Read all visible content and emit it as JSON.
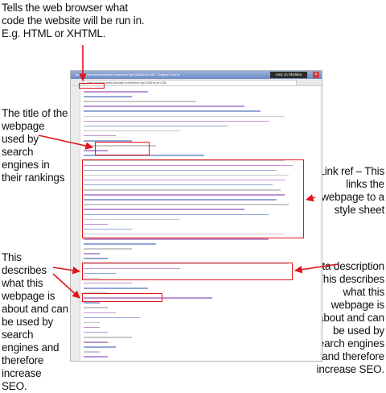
{
  "annotations": {
    "doctype": "Tells the web browser what code the website will be run in. E.g. HTML or XHTML.",
    "title": "The title of the webpage used by search engines in their rankings",
    "link_ref": "Link ref – This links the webpage to a style sheet",
    "meta_left": "This describes what this webpage is about and can be used by search engines and therefore increase SEO.",
    "meta_right": "Meta description – This describes what this webpage is about and can be used by search engines and therefore increase SEO."
  },
  "browser": {
    "tab": "view-source:www.youtube.com/index?gl=GB&hl=en-GB - Original Source",
    "user": "Amy Jo Sheldon",
    "url": "view-source:www.youtube.com/index?gl=GB&hl=en-GB"
  },
  "colors": {
    "highlight": "#e0141b",
    "source_text": "#7a1f9c"
  }
}
